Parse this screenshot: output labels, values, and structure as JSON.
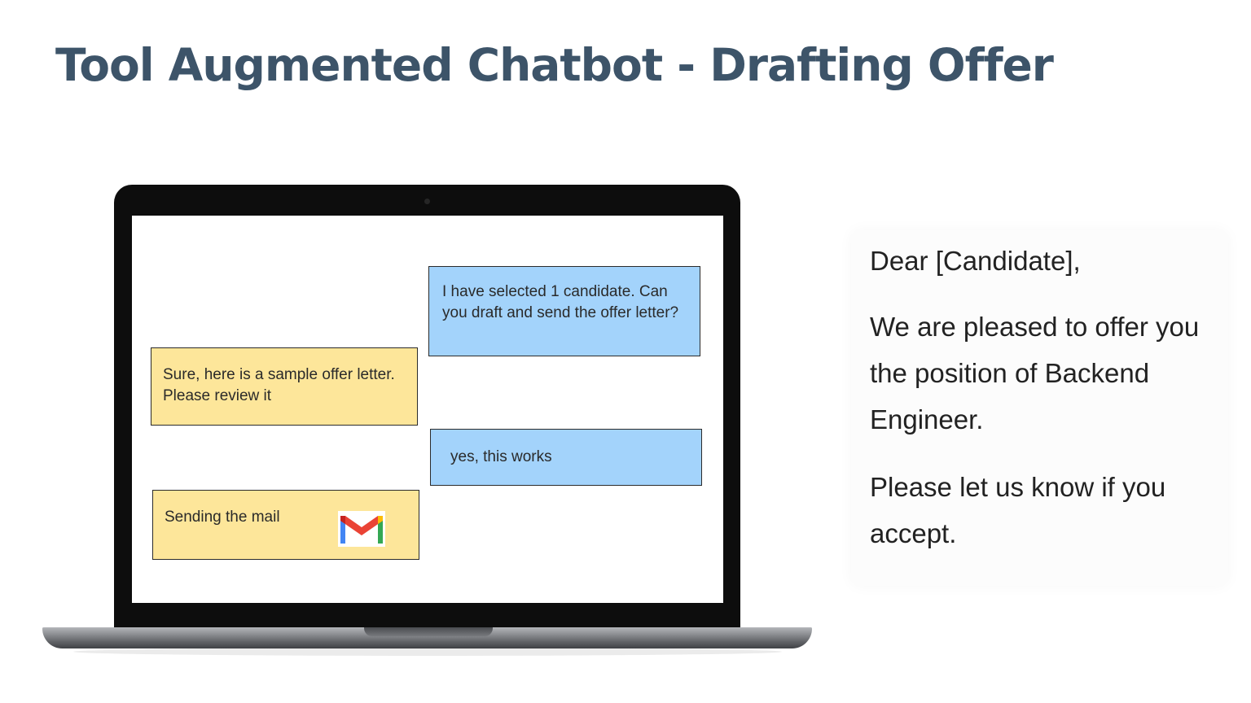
{
  "slide": {
    "title": "Tool Augmented Chatbot - Drafting Offer"
  },
  "chat": {
    "messages": [
      {
        "role": "user",
        "text": "I have selected 1 candidate. Can you draft and send the offer letter?"
      },
      {
        "role": "bot",
        "text": "Sure, here is a sample offer letter. Please review it"
      },
      {
        "role": "user",
        "text": "yes, this works"
      },
      {
        "role": "bot",
        "text": "Sending the mail",
        "icon": "gmail-icon"
      }
    ],
    "colors": {
      "user_bubble": "#a3d3fb",
      "bot_bubble": "#fde69a"
    }
  },
  "letter": {
    "greeting": "Dear [Candidate],",
    "body1": "We are pleased to offer you the position of Backend Engineer.",
    "body2": "Please let us know if you accept."
  },
  "colors": {
    "title": "#3d5469"
  }
}
